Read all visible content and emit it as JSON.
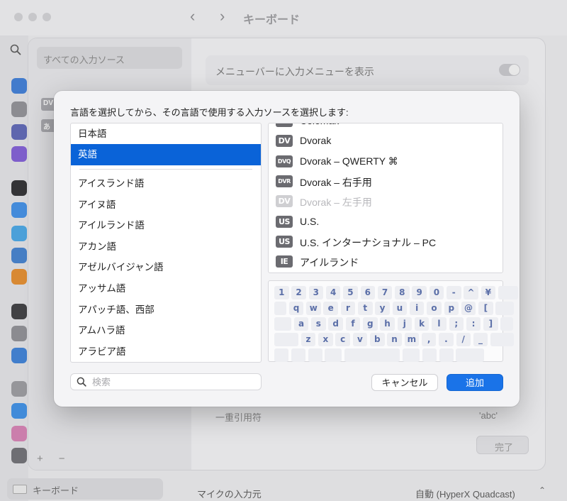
{
  "window": {
    "title": "キーボード"
  },
  "background": {
    "sheet_sidebar_item": "すべての入力ソース",
    "chips": [
      "DV",
      "あ"
    ],
    "show_menu_label": "メニューバーに入力メニューを表示",
    "single_quote_label": "一重引用符",
    "single_quote_value": "'abc'",
    "done_label": "完了",
    "sidebar_bottom_label": "キーボード",
    "mic_label": "マイクの入力元",
    "mic_value": "自動 (HyperX Quadcast)"
  },
  "dialog": {
    "prompt": "言語を選択してから、その言語で使用する入力ソースを選択します:",
    "languages_top": [
      {
        "label": "日本語",
        "selected": false
      },
      {
        "label": "英語",
        "selected": true
      }
    ],
    "languages": [
      "アイスランド語",
      "アイヌ語",
      "アイルランド語",
      "アカン語",
      "アゼルバイジャン語",
      "アッサム語",
      "アパッチ語、西部",
      "アムハラ語",
      "アラビア語"
    ],
    "input_sources": [
      {
        "badge": "DV",
        "label": "Colemak",
        "disabled": false,
        "small": false
      },
      {
        "badge": "DV",
        "label": "Dvorak",
        "disabled": false,
        "small": false
      },
      {
        "badge": "DVQ",
        "label": "Dvorak – QWERTY ⌘",
        "disabled": false,
        "small": true
      },
      {
        "badge": "DVR",
        "label": "Dvorak – 右手用",
        "disabled": false,
        "small": true
      },
      {
        "badge": "DV",
        "label": "Dvorak – 左手用",
        "disabled": true,
        "small": false
      },
      {
        "badge": "US",
        "label": "U.S.",
        "disabled": false,
        "small": false
      },
      {
        "badge": "US",
        "label": "U.S. インターナショナル – PC",
        "disabled": false,
        "small": false
      },
      {
        "badge": "IE",
        "label": "アイルランド",
        "disabled": false,
        "small": false
      }
    ],
    "keyboard_rows": [
      [
        "1",
        "2",
        "3",
        "4",
        "5",
        "6",
        "7",
        "8",
        "9",
        "0",
        "-",
        "^",
        "¥",
        ""
      ],
      [
        "",
        "q",
        "w",
        "e",
        "r",
        "t",
        "y",
        "u",
        "i",
        "o",
        "p",
        "@",
        "[",
        ""
      ],
      [
        "",
        "a",
        "s",
        "d",
        "f",
        "g",
        "h",
        "j",
        "k",
        "l",
        ";",
        ":",
        "]",
        ""
      ],
      [
        "",
        "z",
        "x",
        "c",
        "v",
        "b",
        "n",
        "m",
        ",",
        ".",
        "/",
        "_",
        ""
      ],
      [
        "",
        "",
        "",
        "",
        "",
        "",
        "",
        "",
        ""
      ]
    ],
    "search_placeholder": "検索",
    "cancel_label": "キャンセル",
    "add_label": "追加"
  },
  "colors": {
    "accent": "#1a73e8",
    "selection": "#0a63d8",
    "key_text": "#5b6fa8"
  }
}
